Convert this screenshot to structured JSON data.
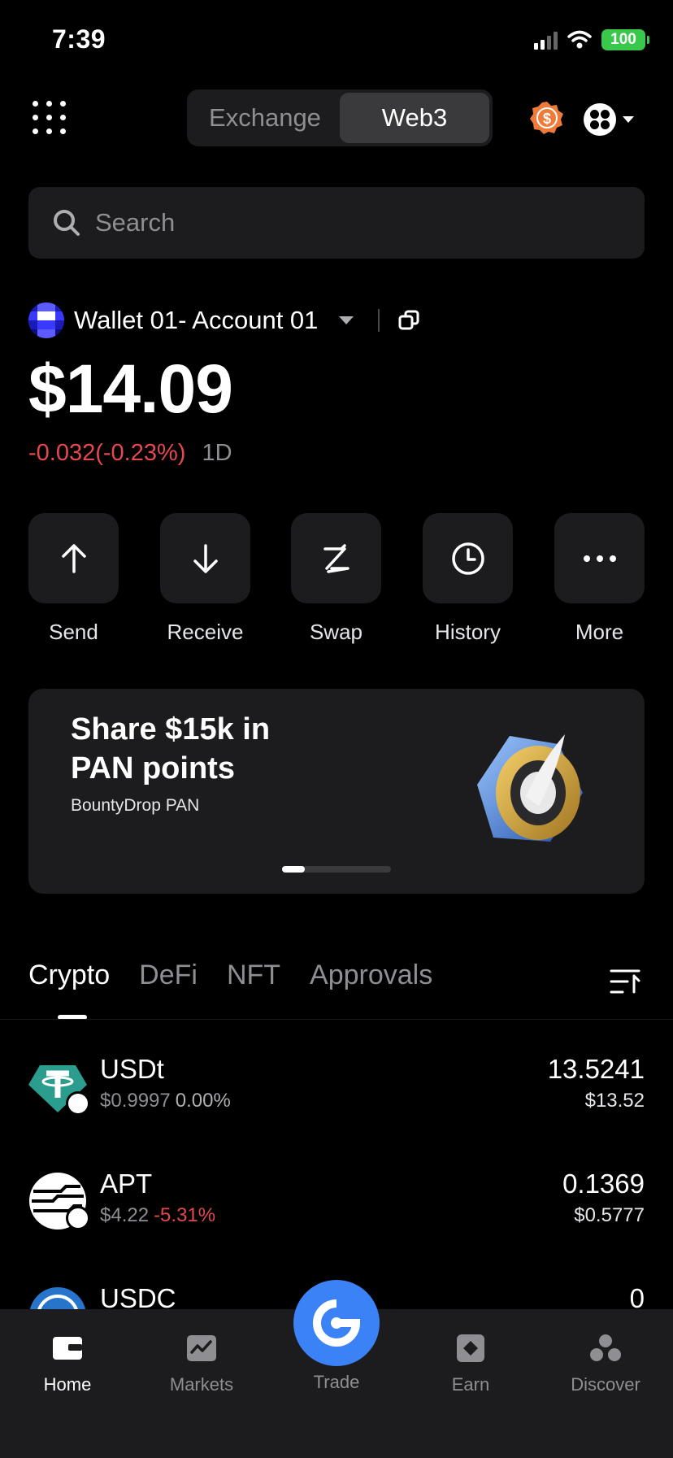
{
  "status_bar": {
    "time": "7:39",
    "battery": "100"
  },
  "header": {
    "segments": [
      "Exchange",
      "Web3"
    ],
    "active_segment": "Web3"
  },
  "search": {
    "placeholder": "Search"
  },
  "account": {
    "name": "Wallet 01- Account 01",
    "balance": "$14.09",
    "change": "-0.032(-0.23%)",
    "period": "1D"
  },
  "actions": [
    {
      "label": "Send",
      "icon": "arrow-up-icon"
    },
    {
      "label": "Receive",
      "icon": "arrow-down-icon"
    },
    {
      "label": "Swap",
      "icon": "swap-icon"
    },
    {
      "label": "History",
      "icon": "clock-icon"
    },
    {
      "label": "More",
      "icon": "more-icon"
    }
  ],
  "banner": {
    "title": "Share $15k in PAN points",
    "subtitle": "BountyDrop PAN",
    "pager": {
      "current": 1,
      "total": 4
    }
  },
  "tabs": [
    "Crypto",
    "DeFi",
    "NFT",
    "Approvals"
  ],
  "active_tab": "Crypto",
  "tokens": [
    {
      "name": "USDt",
      "price": "$0.9997",
      "change": "0.00%",
      "amount": "13.5241",
      "value": "$13.52",
      "color": "#2a9d8f",
      "negative": false
    },
    {
      "name": "APT",
      "price": "$4.22",
      "change": "-5.31%",
      "amount": "0.1369",
      "value": "$0.5777",
      "color": "#ffffff",
      "negative": true
    },
    {
      "name": "USDC",
      "price": "",
      "change": "",
      "amount": "0",
      "value": "",
      "color": "#2775ca",
      "negative": false
    }
  ],
  "bottom_nav": {
    "items": [
      "Home",
      "Markets",
      "Trade",
      "Earn",
      "Discover"
    ],
    "active": "Home"
  },
  "colors": {
    "accent": "#3b82f6",
    "negative": "#e5484d",
    "battery": "#39c84b",
    "badge": "#f07a3a"
  }
}
